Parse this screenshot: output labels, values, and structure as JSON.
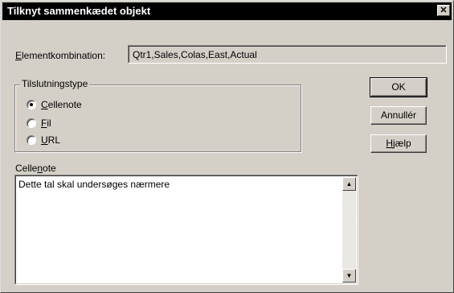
{
  "dialog": {
    "title": "Tilknyt sammenkædet objekt",
    "close_glyph": "✕"
  },
  "combination": {
    "label_mnemonic": "E",
    "label_rest": "lementkombination:",
    "value": "Qtr1,Sales,Colas,East,Actual"
  },
  "connection_type": {
    "legend": "Tilslutningstype",
    "options": [
      {
        "mnemonic": "C",
        "rest": "ellenote",
        "selected": true
      },
      {
        "mnemonic": "F",
        "rest": "il",
        "selected": false
      },
      {
        "mnemonic": "U",
        "rest": "RL",
        "selected": false
      }
    ]
  },
  "buttons": {
    "ok": "OK",
    "cancel": "Annullér",
    "help_mnemonic": "H",
    "help_rest": "jælp"
  },
  "cellnote": {
    "label_pre": "Celle",
    "label_mnemonic": "n",
    "label_post": "ote",
    "text": "Dette tal skal undersøges nærmere"
  },
  "scrollbar": {
    "up_glyph": "▲",
    "down_glyph": "▼"
  }
}
